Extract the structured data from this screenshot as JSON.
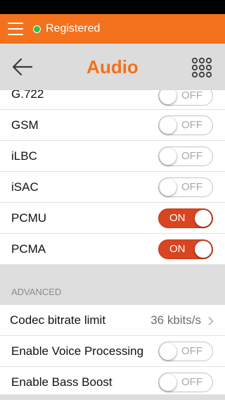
{
  "topbar": {
    "status": "Registered"
  },
  "navbar": {
    "title": "Audio"
  },
  "codecs": [
    {
      "name": "G.722",
      "state": "OFF"
    },
    {
      "name": "GSM",
      "state": "OFF"
    },
    {
      "name": "iLBC",
      "state": "OFF"
    },
    {
      "name": "iSAC",
      "state": "OFF"
    },
    {
      "name": "PCMU",
      "state": "ON"
    },
    {
      "name": "PCMA",
      "state": "ON"
    }
  ],
  "advanced": {
    "header": "ADVANCED",
    "bitrate_label": "Codec bitrate limit",
    "bitrate_value": "36 kbits/s",
    "voice_processing_label": "Enable Voice Processing",
    "voice_processing_state": "OFF",
    "bass_boost_label": "Enable Bass Boost",
    "bass_boost_state": "OFF"
  },
  "colors": {
    "accent": "#f4711d",
    "toggle_on": "#d84520",
    "registered_dot": "#2ec54a"
  }
}
